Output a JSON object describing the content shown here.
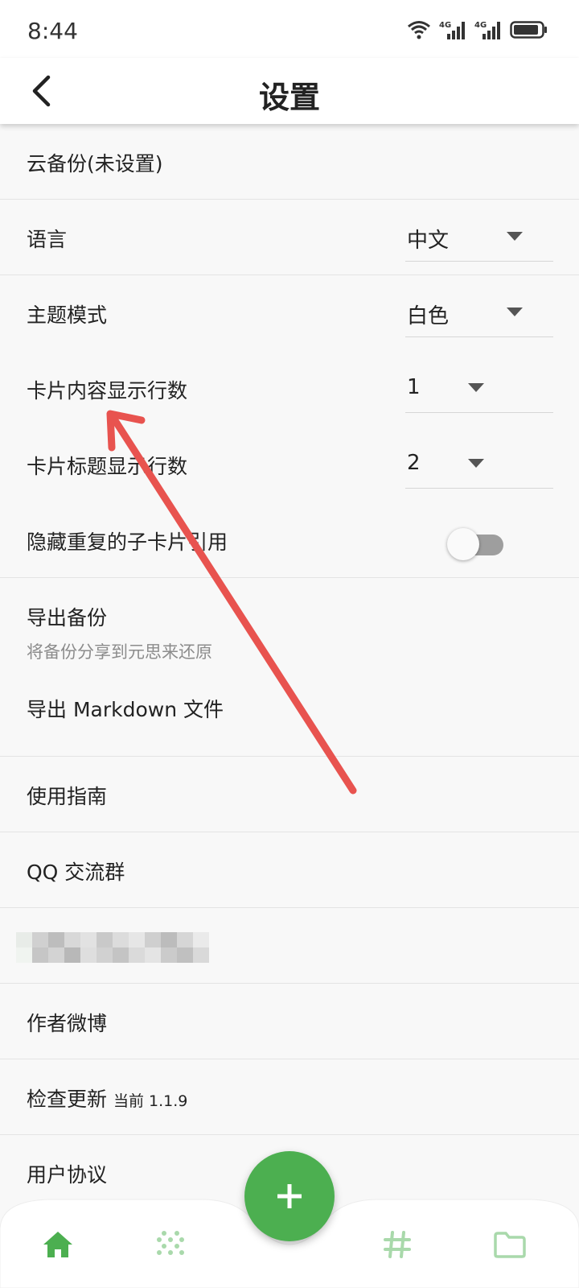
{
  "status_bar": {
    "time": "8:44"
  },
  "app_bar": {
    "title": "设置"
  },
  "settings": {
    "cloud_backup": "云备份(未设置)",
    "language": {
      "label": "语言",
      "value": "中文"
    },
    "theme": {
      "label": "主题模式",
      "value": "白色"
    },
    "card_content_lines": {
      "label": "卡片内容显示行数",
      "value": "1"
    },
    "card_title_lines": {
      "label": "卡片标题显示行数",
      "value": "2"
    },
    "hide_duplicate_refs": {
      "label": "隐藏重复的子卡片引用",
      "enabled": false
    },
    "export_backup": {
      "label": "导出备份",
      "sublabel": "将备份分享到元思来还原"
    },
    "export_markdown": "导出 Markdown 文件",
    "guide": "使用指南",
    "qq_group": "QQ 交流群",
    "author_weibo": "作者微博",
    "check_update": {
      "label": "检查更新",
      "version": "当前 1.1.9"
    },
    "user_agreement": "用户协议"
  },
  "colors": {
    "accent": "#4caf50",
    "annotation_arrow": "#e8534f"
  }
}
